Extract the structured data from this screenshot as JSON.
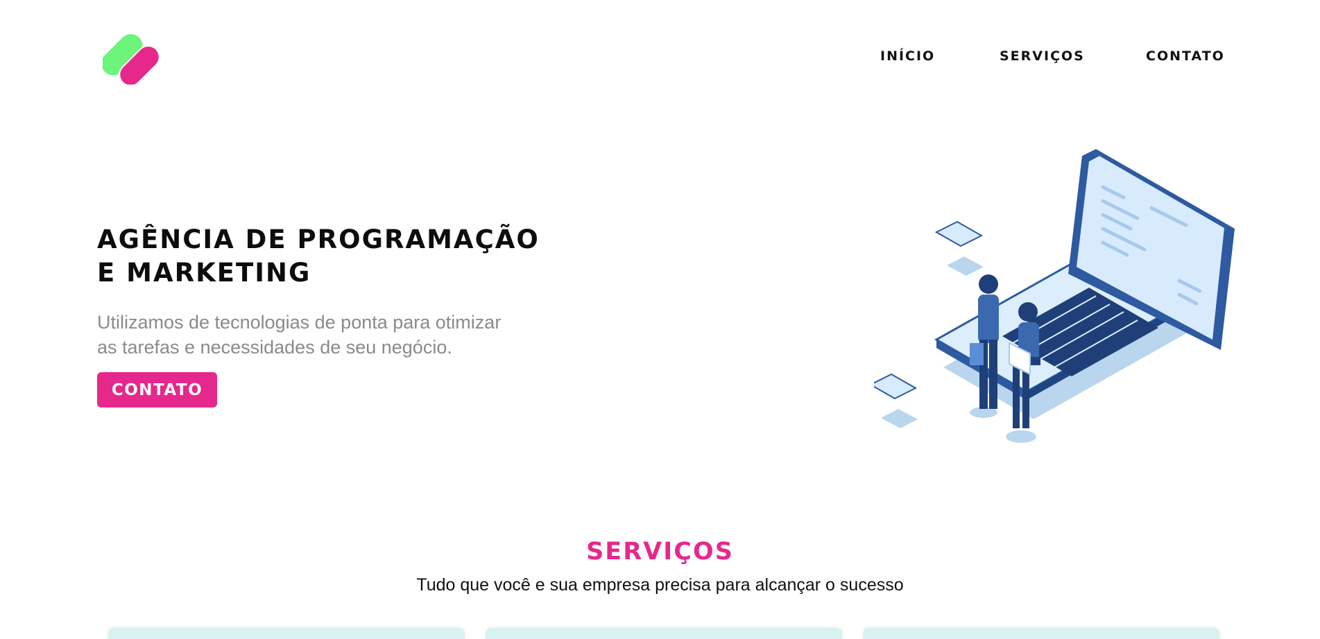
{
  "brand": {
    "logo_icon": "logo-capsule-icon",
    "colors": {
      "green": "#6cf57a",
      "pink": "#e6288c"
    }
  },
  "nav": {
    "items": [
      {
        "label": "INÍCIO"
      },
      {
        "label": "SERVIÇOS"
      },
      {
        "label": "CONTATO"
      }
    ]
  },
  "hero": {
    "title_line1": "AGÊNCIA DE PROGRAMAÇÃO",
    "title_line2": "E MARKETING",
    "subtitle_line1": "Utilizamos de tecnologias de ponta para otimizar",
    "subtitle_line2": "as tarefas e necessidades de seu negócio.",
    "button_label": "CONTATO",
    "illustration_icon": "isometric-laptop-people-illustration",
    "accent": "#e6288c"
  },
  "services": {
    "title": "SERVIÇOS",
    "subtitle": "Tudo que você e sua empresa precisa para alcançar o sucesso",
    "card_color": "#d9f1f0",
    "cards": [
      {},
      {},
      {}
    ]
  }
}
